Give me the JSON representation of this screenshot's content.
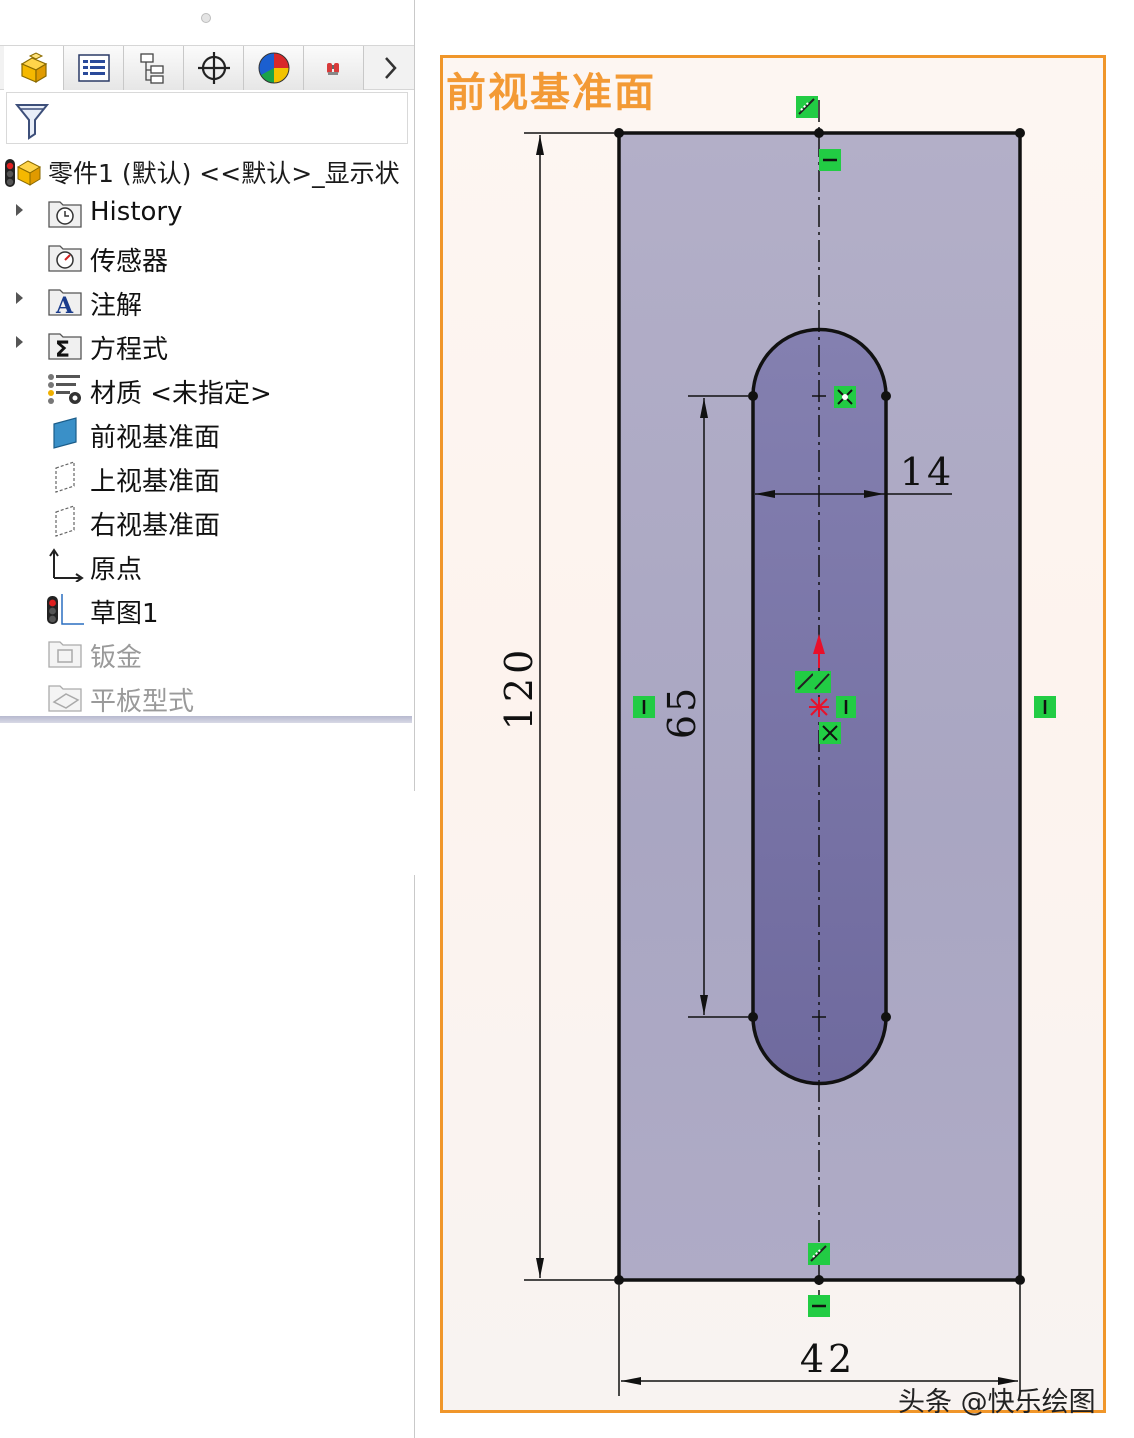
{
  "feature_tree": {
    "tabs": [
      {
        "name": "featuremanager-tab-icon",
        "active": true
      },
      {
        "name": "propertymanager-tab-icon",
        "active": false
      },
      {
        "name": "configurationmanager-tab-icon",
        "active": false
      },
      {
        "name": "dimxpertmanager-tab-icon",
        "active": false
      },
      {
        "name": "displaymanager-tab-icon",
        "active": false
      },
      {
        "name": "cam-tab-icon",
        "active": false
      }
    ],
    "root_label": "零件1 (默认) <<默认>_显示状",
    "items": [
      {
        "label": "History",
        "expandable": true,
        "icon": "history-folder-icon"
      },
      {
        "label": "传感器",
        "expandable": false,
        "icon": "sensors-folder-icon"
      },
      {
        "label": "注解",
        "expandable": true,
        "icon": "annotations-folder-icon"
      },
      {
        "label": "方程式",
        "expandable": true,
        "icon": "equations-folder-icon"
      },
      {
        "label": "材质 <未指定>",
        "expandable": false,
        "icon": "material-icon"
      },
      {
        "label": "前视基准面",
        "expandable": false,
        "icon": "front-plane-icon"
      },
      {
        "label": "上视基准面",
        "expandable": false,
        "icon": "top-plane-icon"
      },
      {
        "label": "右视基准面",
        "expandable": false,
        "icon": "right-plane-icon"
      },
      {
        "label": "原点",
        "expandable": false,
        "icon": "origin-icon"
      },
      {
        "label": "草图1",
        "expandable": false,
        "icon": "sketch-icon"
      },
      {
        "label": "钣金",
        "expandable": false,
        "icon": "sheet-metal-icon",
        "disabled": true
      },
      {
        "label": "平板型式",
        "expandable": false,
        "icon": "flat-pattern-icon",
        "disabled": true
      }
    ]
  },
  "graphics": {
    "plane_label": "前视基准面",
    "dimensions": {
      "height": "120",
      "width": "42",
      "slot_length": "65",
      "slot_width": "14"
    },
    "colors": {
      "plane_border": "#f0962a",
      "plane_label": "#f39a35",
      "region_fill": "#aaa6c3",
      "slot_fill": "#7a75a6",
      "relation_badge": "#22cc44",
      "origin": "#e8102a"
    },
    "watermark": "头条 @快乐绘图"
  }
}
